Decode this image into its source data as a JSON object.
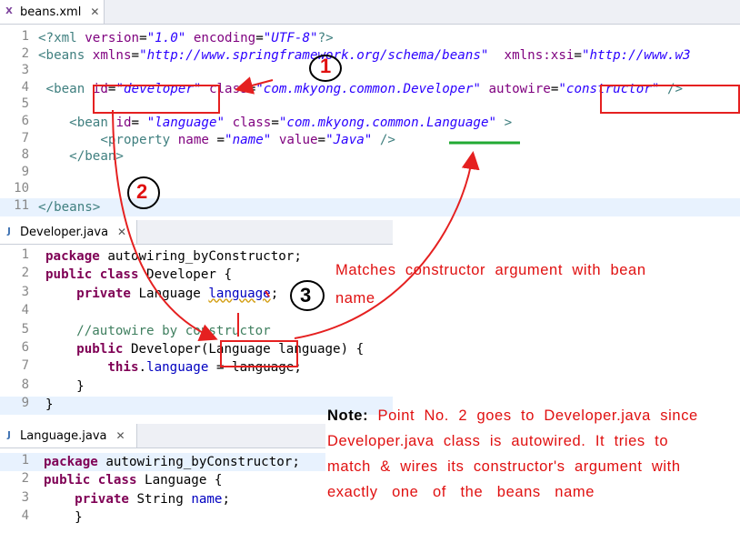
{
  "xml_tab": {
    "label": "beans.xml",
    "close": "✕"
  },
  "xml_lines": [
    {
      "n": "1",
      "html": "<span class='tg'>&lt;?</span><span class='tg'>xml</span> <span class='at'>version</span>=<span class='av'>\"1.0\"</span> <span class='at'>encoding</span>=<span class='av'>\"UTF-8\"</span><span class='tg'>?&gt;</span>"
    },
    {
      "n": "2",
      "html": "<span class='tg'>&lt;beans</span> <span class='at'>xmlns</span>=<span class='av'>\"http://www.springframework.org/schema/beans\"</span>  <span class='at'>xmlns:xsi</span>=<span class='av'>\"http://www.w3</span>"
    },
    {
      "n": "3",
      "html": ""
    },
    {
      "n": "4",
      "html": " <span class='tg'>&lt;bean</span> <span class='at'>id</span>=<span class='av'>\"developer\"</span> <span class='at'>class</span>=<span class='av'>\"com.mkyong.common.Developer\"</span> <span class='at'>autowire</span>=<span class='av'>\"constructor\"</span> <span class='tg'>/&gt;</span>"
    },
    {
      "n": "5",
      "html": ""
    },
    {
      "n": "6",
      "html": "    <span class='tg'>&lt;bean</span> <span class='at'>id</span>= <span class='av'>\"language\"</span> <span class='at'>class</span>=<span class='av'>\"com.mkyong.common.Language\"</span> <span class='tg'>&gt;</span>"
    },
    {
      "n": "7",
      "html": "        <span class='tg'>&lt;property</span> <span class='at'>name</span> =<span class='av'>\"name\"</span> <span class='at'>value</span>=<span class='av'>\"Java\"</span> <span class='tg'>/&gt;</span>"
    },
    {
      "n": "8",
      "html": "    <span class='tg'>&lt;/bean&gt;</span>"
    },
    {
      "n": "9",
      "html": ""
    },
    {
      "n": "10",
      "html": ""
    },
    {
      "n": "11",
      "html": "<span class='tg'>&lt;/beans&gt;</span>"
    }
  ],
  "dev_tab": {
    "label": "Developer.java",
    "close": "✕"
  },
  "dev_lines": [
    {
      "n": "1",
      "html": "<span class='kw'>package</span> autowiring_byConstructor;"
    },
    {
      "n": "2",
      "html": "<span class='kw'>public</span> <span class='kw'>class</span> Developer {"
    },
    {
      "n": "3",
      "html": "    <span class='kw'>private</span> Language <span class='fd sq'>language</span>;"
    },
    {
      "n": "4",
      "html": ""
    },
    {
      "n": "5",
      "html": "    <span class='cm'>//autowire by constructor</span>"
    },
    {
      "n": "6",
      "html": "    <span class='kw'>public</span> Developer(Language language) {"
    },
    {
      "n": "7",
      "html": "        <span class='kw'>this</span>.<span class='fd'>language</span> = language;"
    },
    {
      "n": "8",
      "html": "    }"
    },
    {
      "n": "9",
      "html": "}"
    }
  ],
  "lang_tab": {
    "label": "Language.java",
    "close": "✕"
  },
  "lang_lines": [
    {
      "n": "1",
      "html": "<span class='kw'>package</span> autowiring_byConstructor;"
    },
    {
      "n": "2",
      "html": "<span class='kw'>public</span> <span class='kw'>class</span> Language {"
    },
    {
      "n": "3",
      "html": "    <span class='kw'>private</span> String <span class='fd'>name</span>;"
    },
    {
      "n": "4",
      "html": "    }"
    }
  ],
  "annotations": {
    "num1": "1",
    "num2": "2",
    "num3": "3",
    "match_line1": "Matches  constructor  argument  with  bean",
    "match_line2": "name",
    "note_label": "Note:",
    "note_line1": "  Point  No.  2  goes  to  Developer.java  since",
    "note_line2": "Developer.java  class  is  autowired.  It  tries  to",
    "note_line3": "match  &  wires  its  constructor's  argument  with",
    "note_line4": "exactly   one   of   the   beans   name"
  }
}
